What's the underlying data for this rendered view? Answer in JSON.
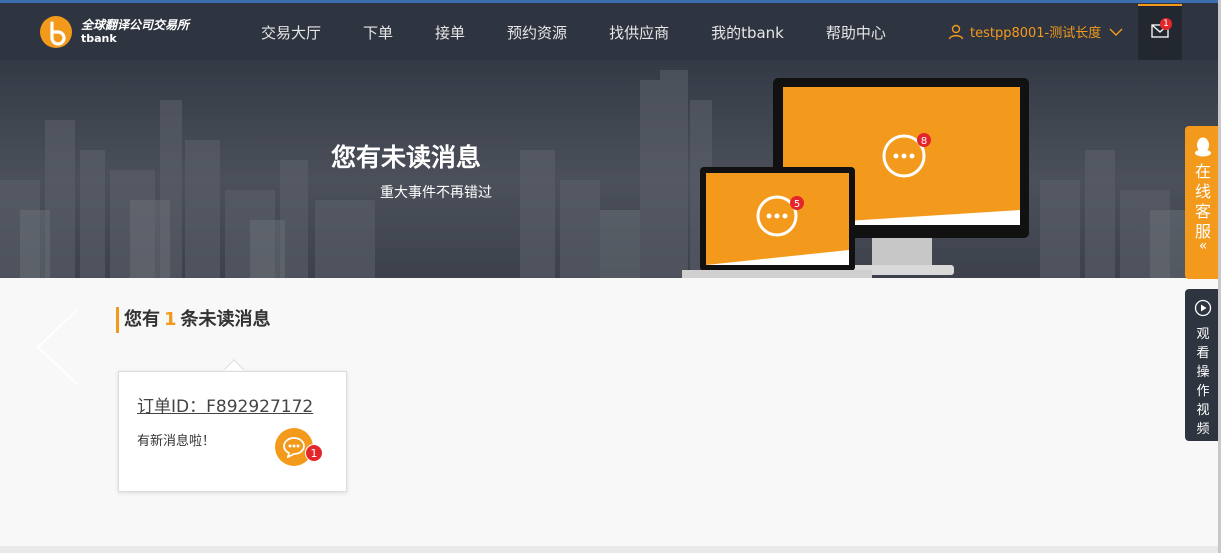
{
  "header": {
    "logo": {
      "name_cn": "全球翻译公司交易所",
      "name_en": "tbank"
    },
    "nav": [
      {
        "label": "交易大厅"
      },
      {
        "label": "下单"
      },
      {
        "label": "接单"
      },
      {
        "label": "预约资源"
      },
      {
        "label": "找供应商"
      },
      {
        "label": "我的tbank"
      },
      {
        "label": "帮助中心"
      }
    ],
    "user": {
      "name": "testpp8001-测试长度"
    },
    "messages": {
      "count": "1"
    }
  },
  "banner": {
    "title": "您有未读消息",
    "subtitle": "重大事件不再错过",
    "laptop_badge": "5",
    "monitor_badge": "8"
  },
  "unread": {
    "prefix": "您有",
    "count": "1",
    "suffix": "条未读消息"
  },
  "card": {
    "order_id": "订单ID：F892927172",
    "message": "有新消息啦！",
    "badge": "1"
  },
  "sidebar": {
    "online_service": "在线客服",
    "collapse_arrow": "«",
    "watch_video": "观看操作视频"
  },
  "colors": {
    "accent": "#f39a1d",
    "header_bg": "#2f3540",
    "badge": "#e4262b"
  }
}
